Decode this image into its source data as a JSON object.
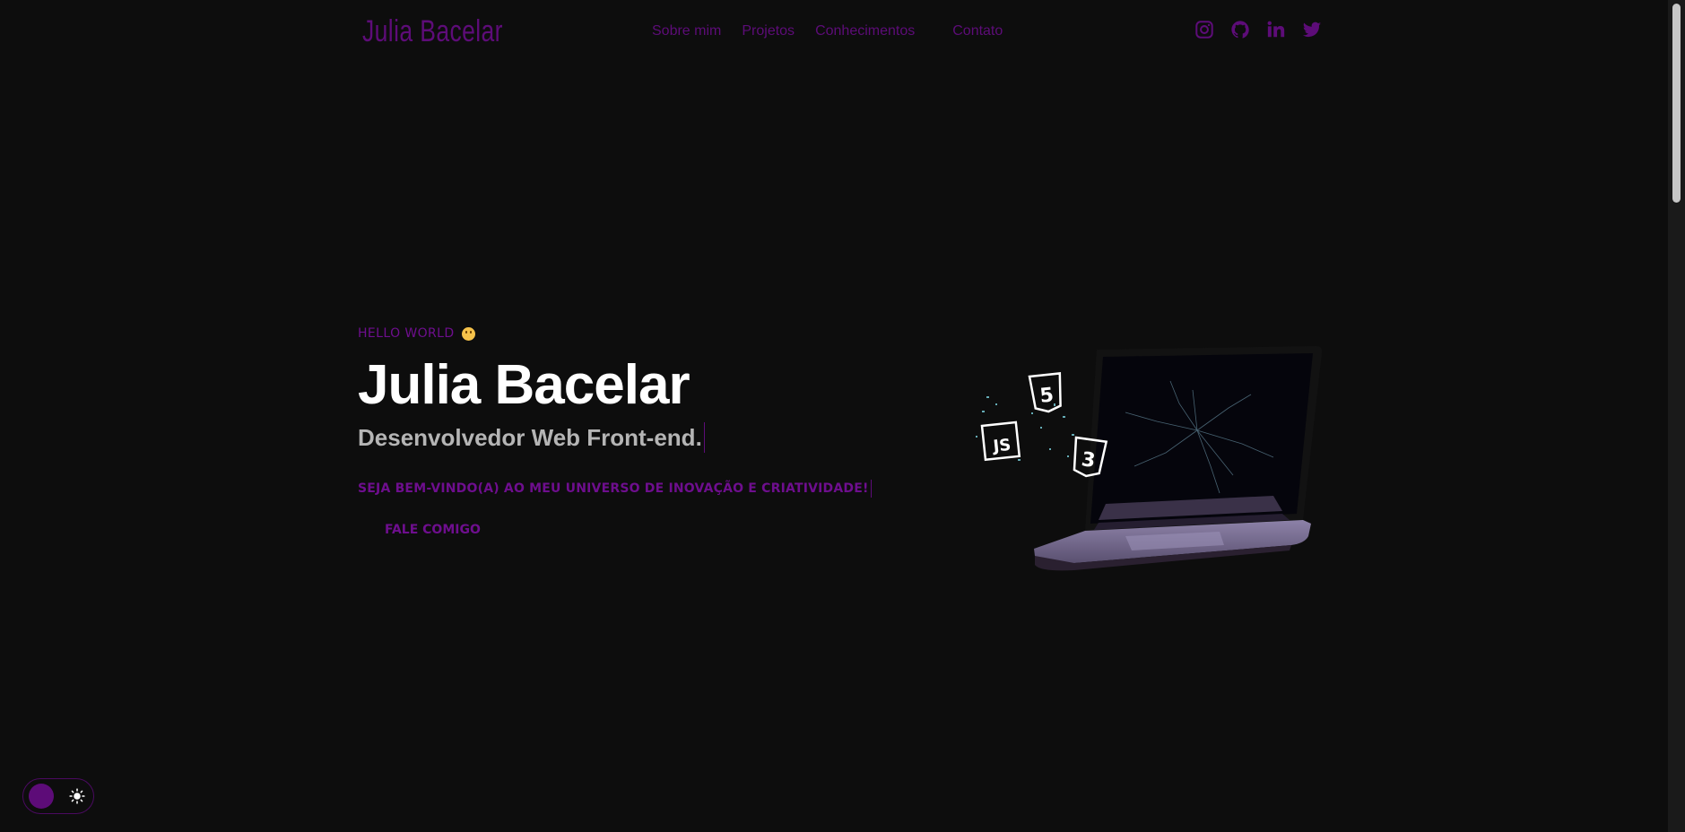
{
  "header": {
    "logo": "Julia Bacelar",
    "menu": [
      {
        "label": "Sobre mim"
      },
      {
        "label": "Projetos"
      },
      {
        "label": "Conhecimentos"
      },
      {
        "label": "Contato"
      }
    ],
    "socials": [
      "instagram-icon",
      "github-icon",
      "linkedin-icon",
      "twitter-icon"
    ]
  },
  "hero": {
    "greeting": "HELLO WORLD",
    "name": "Julia Bacelar",
    "role": "Desenvolvedor Web Front-end.",
    "welcome": "SEJA BEM-VINDO(A) AO MEU UNIVERSO DE INOVAÇÃO E CRIATIVIDADE!",
    "cta": "FALE COMIGO"
  },
  "laptop_badges": [
    "5",
    "JS",
    "3"
  ],
  "theme_toggle": {
    "mode": "dark",
    "icon": "sun-icon"
  },
  "colors": {
    "background": "#0d0d0d",
    "accent": "#5d0c78",
    "title": "#ffffff",
    "subtitle": "#b5b5b5"
  }
}
